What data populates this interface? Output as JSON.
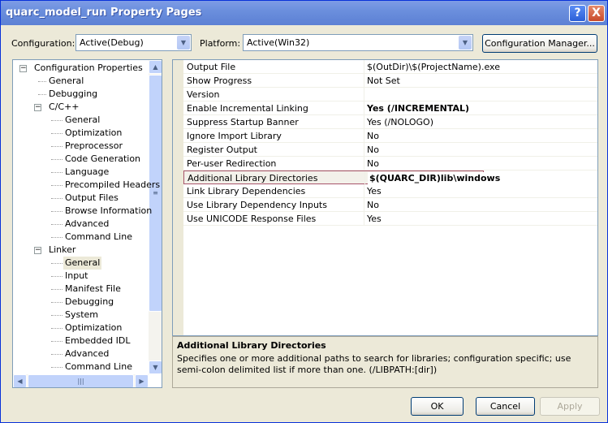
{
  "title": "quarc_model_run Property Pages",
  "title_buttons": {
    "help": "?",
    "close": "X"
  },
  "configuration": {
    "label": "Configuration:",
    "value": "Active(Debug)"
  },
  "platform": {
    "label": "Platform:",
    "value": "Active(Win32)"
  },
  "config_manager": "Configuration Manager...",
  "tree": [
    {
      "label": "Configuration Properties",
      "level": 0,
      "expander": "−"
    },
    {
      "label": "General",
      "level": 1
    },
    {
      "label": "Debugging",
      "level": 1
    },
    {
      "label": "C/C++",
      "level": 1,
      "expander": "−"
    },
    {
      "label": "General",
      "level": 2
    },
    {
      "label": "Optimization",
      "level": 2
    },
    {
      "label": "Preprocessor",
      "level": 2
    },
    {
      "label": "Code Generation",
      "level": 2
    },
    {
      "label": "Language",
      "level": 2
    },
    {
      "label": "Precompiled Headers",
      "level": 2
    },
    {
      "label": "Output Files",
      "level": 2
    },
    {
      "label": "Browse Information",
      "level": 2
    },
    {
      "label": "Advanced",
      "level": 2
    },
    {
      "label": "Command Line",
      "level": 2
    },
    {
      "label": "Linker",
      "level": 1,
      "expander": "−"
    },
    {
      "label": "General",
      "level": 2,
      "selected": true
    },
    {
      "label": "Input",
      "level": 2
    },
    {
      "label": "Manifest File",
      "level": 2
    },
    {
      "label": "Debugging",
      "level": 2
    },
    {
      "label": "System",
      "level": 2
    },
    {
      "label": "Optimization",
      "level": 2
    },
    {
      "label": "Embedded IDL",
      "level": 2
    },
    {
      "label": "Advanced",
      "level": 2
    },
    {
      "label": "Command Line",
      "level": 2
    }
  ],
  "properties": [
    {
      "name": "Output File",
      "value": "$(OutDir)\\$(ProjectName).exe"
    },
    {
      "name": "Show Progress",
      "value": "Not Set"
    },
    {
      "name": "Version",
      "value": ""
    },
    {
      "name": "Enable Incremental Linking",
      "value": "Yes (/INCREMENTAL)",
      "bold": true
    },
    {
      "name": "Suppress Startup Banner",
      "value": "Yes (/NOLOGO)"
    },
    {
      "name": "Ignore Import Library",
      "value": "No"
    },
    {
      "name": "Register Output",
      "value": "No"
    },
    {
      "name": "Per-user Redirection",
      "value": "No"
    },
    {
      "name": "Additional Library Directories",
      "value": "$(QUARC_DIR)lib\\windows",
      "bold": true,
      "selected": true
    },
    {
      "name": "Link Library Dependencies",
      "value": "Yes"
    },
    {
      "name": "Use Library Dependency Inputs",
      "value": "No"
    },
    {
      "name": "Use UNICODE Response Files",
      "value": "Yes"
    }
  ],
  "description": {
    "title": "Additional Library Directories",
    "text": "Specifies one or more additional paths to search for libraries; configuration specific; use semi-colon delimited list if more than one.     (/LIBPATH:[dir])"
  },
  "buttons": {
    "ok": "OK",
    "cancel": "Cancel",
    "apply": "Apply"
  }
}
